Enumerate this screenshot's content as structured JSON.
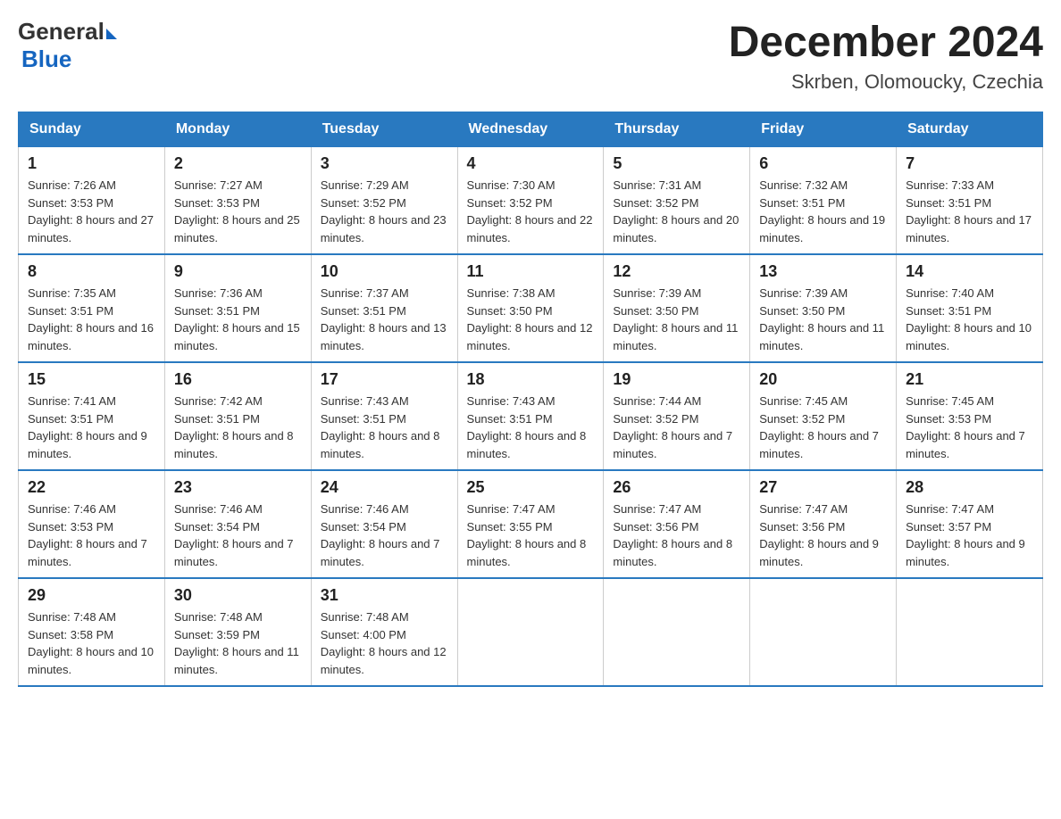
{
  "logo": {
    "general": "General",
    "blue": "Blue"
  },
  "header": {
    "month": "December 2024",
    "location": "Skrben, Olomoucky, Czechia"
  },
  "days_of_week": [
    "Sunday",
    "Monday",
    "Tuesday",
    "Wednesday",
    "Thursday",
    "Friday",
    "Saturday"
  ],
  "weeks": [
    [
      {
        "day": "1",
        "sunrise": "7:26 AM",
        "sunset": "3:53 PM",
        "daylight": "8 hours and 27 minutes."
      },
      {
        "day": "2",
        "sunrise": "7:27 AM",
        "sunset": "3:53 PM",
        "daylight": "8 hours and 25 minutes."
      },
      {
        "day": "3",
        "sunrise": "7:29 AM",
        "sunset": "3:52 PM",
        "daylight": "8 hours and 23 minutes."
      },
      {
        "day": "4",
        "sunrise": "7:30 AM",
        "sunset": "3:52 PM",
        "daylight": "8 hours and 22 minutes."
      },
      {
        "day": "5",
        "sunrise": "7:31 AM",
        "sunset": "3:52 PM",
        "daylight": "8 hours and 20 minutes."
      },
      {
        "day": "6",
        "sunrise": "7:32 AM",
        "sunset": "3:51 PM",
        "daylight": "8 hours and 19 minutes."
      },
      {
        "day": "7",
        "sunrise": "7:33 AM",
        "sunset": "3:51 PM",
        "daylight": "8 hours and 17 minutes."
      }
    ],
    [
      {
        "day": "8",
        "sunrise": "7:35 AM",
        "sunset": "3:51 PM",
        "daylight": "8 hours and 16 minutes."
      },
      {
        "day": "9",
        "sunrise": "7:36 AM",
        "sunset": "3:51 PM",
        "daylight": "8 hours and 15 minutes."
      },
      {
        "day": "10",
        "sunrise": "7:37 AM",
        "sunset": "3:51 PM",
        "daylight": "8 hours and 13 minutes."
      },
      {
        "day": "11",
        "sunrise": "7:38 AM",
        "sunset": "3:50 PM",
        "daylight": "8 hours and 12 minutes."
      },
      {
        "day": "12",
        "sunrise": "7:39 AM",
        "sunset": "3:50 PM",
        "daylight": "8 hours and 11 minutes."
      },
      {
        "day": "13",
        "sunrise": "7:39 AM",
        "sunset": "3:50 PM",
        "daylight": "8 hours and 11 minutes."
      },
      {
        "day": "14",
        "sunrise": "7:40 AM",
        "sunset": "3:51 PM",
        "daylight": "8 hours and 10 minutes."
      }
    ],
    [
      {
        "day": "15",
        "sunrise": "7:41 AM",
        "sunset": "3:51 PM",
        "daylight": "8 hours and 9 minutes."
      },
      {
        "day": "16",
        "sunrise": "7:42 AM",
        "sunset": "3:51 PM",
        "daylight": "8 hours and 8 minutes."
      },
      {
        "day": "17",
        "sunrise": "7:43 AM",
        "sunset": "3:51 PM",
        "daylight": "8 hours and 8 minutes."
      },
      {
        "day": "18",
        "sunrise": "7:43 AM",
        "sunset": "3:51 PM",
        "daylight": "8 hours and 8 minutes."
      },
      {
        "day": "19",
        "sunrise": "7:44 AM",
        "sunset": "3:52 PM",
        "daylight": "8 hours and 7 minutes."
      },
      {
        "day": "20",
        "sunrise": "7:45 AM",
        "sunset": "3:52 PM",
        "daylight": "8 hours and 7 minutes."
      },
      {
        "day": "21",
        "sunrise": "7:45 AM",
        "sunset": "3:53 PM",
        "daylight": "8 hours and 7 minutes."
      }
    ],
    [
      {
        "day": "22",
        "sunrise": "7:46 AM",
        "sunset": "3:53 PM",
        "daylight": "8 hours and 7 minutes."
      },
      {
        "day": "23",
        "sunrise": "7:46 AM",
        "sunset": "3:54 PM",
        "daylight": "8 hours and 7 minutes."
      },
      {
        "day": "24",
        "sunrise": "7:46 AM",
        "sunset": "3:54 PM",
        "daylight": "8 hours and 7 minutes."
      },
      {
        "day": "25",
        "sunrise": "7:47 AM",
        "sunset": "3:55 PM",
        "daylight": "8 hours and 8 minutes."
      },
      {
        "day": "26",
        "sunrise": "7:47 AM",
        "sunset": "3:56 PM",
        "daylight": "8 hours and 8 minutes."
      },
      {
        "day": "27",
        "sunrise": "7:47 AM",
        "sunset": "3:56 PM",
        "daylight": "8 hours and 9 minutes."
      },
      {
        "day": "28",
        "sunrise": "7:47 AM",
        "sunset": "3:57 PM",
        "daylight": "8 hours and 9 minutes."
      }
    ],
    [
      {
        "day": "29",
        "sunrise": "7:48 AM",
        "sunset": "3:58 PM",
        "daylight": "8 hours and 10 minutes."
      },
      {
        "day": "30",
        "sunrise": "7:48 AM",
        "sunset": "3:59 PM",
        "daylight": "8 hours and 11 minutes."
      },
      {
        "day": "31",
        "sunrise": "7:48 AM",
        "sunset": "4:00 PM",
        "daylight": "8 hours and 12 minutes."
      },
      null,
      null,
      null,
      null
    ]
  ]
}
